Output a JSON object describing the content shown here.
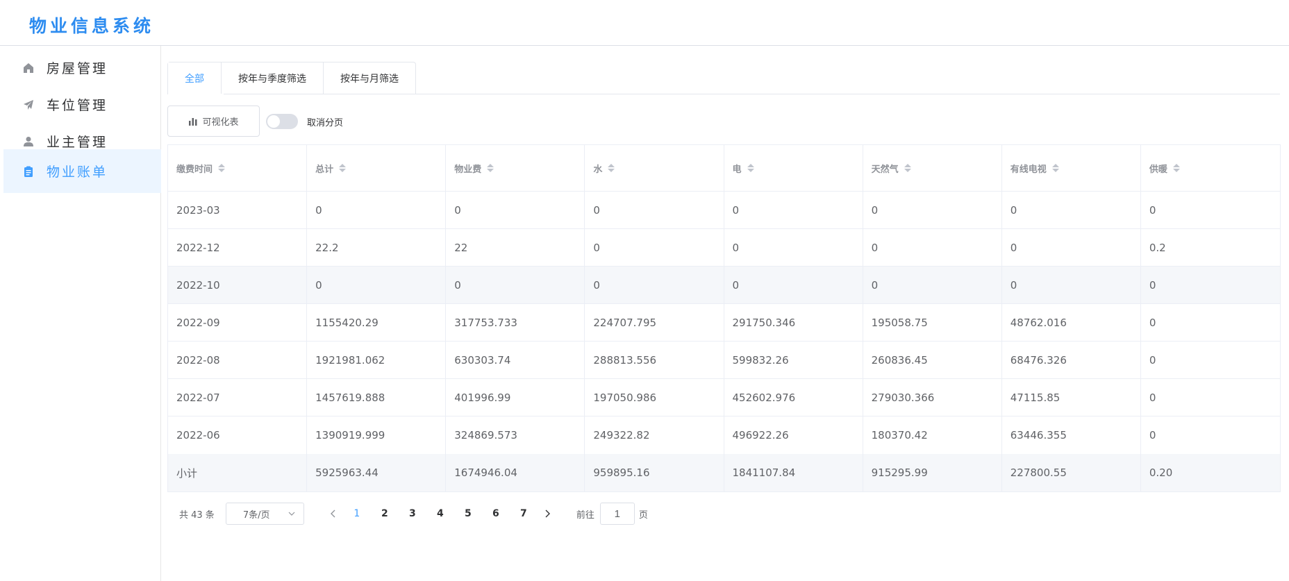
{
  "app": {
    "title": "物业信息系统"
  },
  "sidebar": {
    "items": [
      {
        "label": "房屋管理",
        "icon": "home-icon"
      },
      {
        "label": "车位管理",
        "icon": "paper-plane-icon"
      },
      {
        "label": "业主管理",
        "icon": "user-icon"
      },
      {
        "label": "物业账单",
        "icon": "clipboard-icon",
        "active": true
      }
    ]
  },
  "tabs": [
    {
      "label": "全部",
      "active": true
    },
    {
      "label": "按年与季度筛选"
    },
    {
      "label": "按年与月筛选"
    }
  ],
  "toolbar": {
    "viz_label": "可视化表",
    "switch_label": "取消分页"
  },
  "table": {
    "columns": [
      "缴费时间",
      "总计",
      "物业费",
      "水",
      "电",
      "天然气",
      "有线电视",
      "供暖"
    ],
    "rows": [
      [
        "2023-03",
        "0",
        "0",
        "0",
        "0",
        "0",
        "0",
        "0"
      ],
      [
        "2022-12",
        "22.2",
        "22",
        "0",
        "0",
        "0",
        "0",
        "0.2"
      ],
      [
        "2022-10",
        "0",
        "0",
        "0",
        "0",
        "0",
        "0",
        "0"
      ],
      [
        "2022-09",
        "1155420.29",
        "317753.733",
        "224707.795",
        "291750.346",
        "195058.75",
        "48762.016",
        "0"
      ],
      [
        "2022-08",
        "1921981.062",
        "630303.74",
        "288813.556",
        "599832.26",
        "260836.45",
        "68476.326",
        "0"
      ],
      [
        "2022-07",
        "1457619.888",
        "401996.99",
        "197050.986",
        "452602.976",
        "279030.366",
        "47115.85",
        "0"
      ],
      [
        "2022-06",
        "1390919.999",
        "324869.573",
        "249322.82",
        "496922.26",
        "180370.42",
        "63446.355",
        "0"
      ]
    ],
    "summary": [
      "小计",
      "5925963.44",
      "1674946.04",
      "959895.16",
      "1841107.84",
      "915295.99",
      "227800.55",
      "0.20"
    ]
  },
  "pagination": {
    "total": "共 43 条",
    "page_size": "7条/页",
    "pages": [
      "1",
      "2",
      "3",
      "4",
      "5",
      "6",
      "7"
    ],
    "current": "1",
    "goto_label": "前往",
    "goto_value": "1",
    "goto_suffix": "页"
  },
  "colors": {
    "accent": "#409eff",
    "title": "#2d8cf0",
    "active_bg": "#ecf5ff"
  }
}
